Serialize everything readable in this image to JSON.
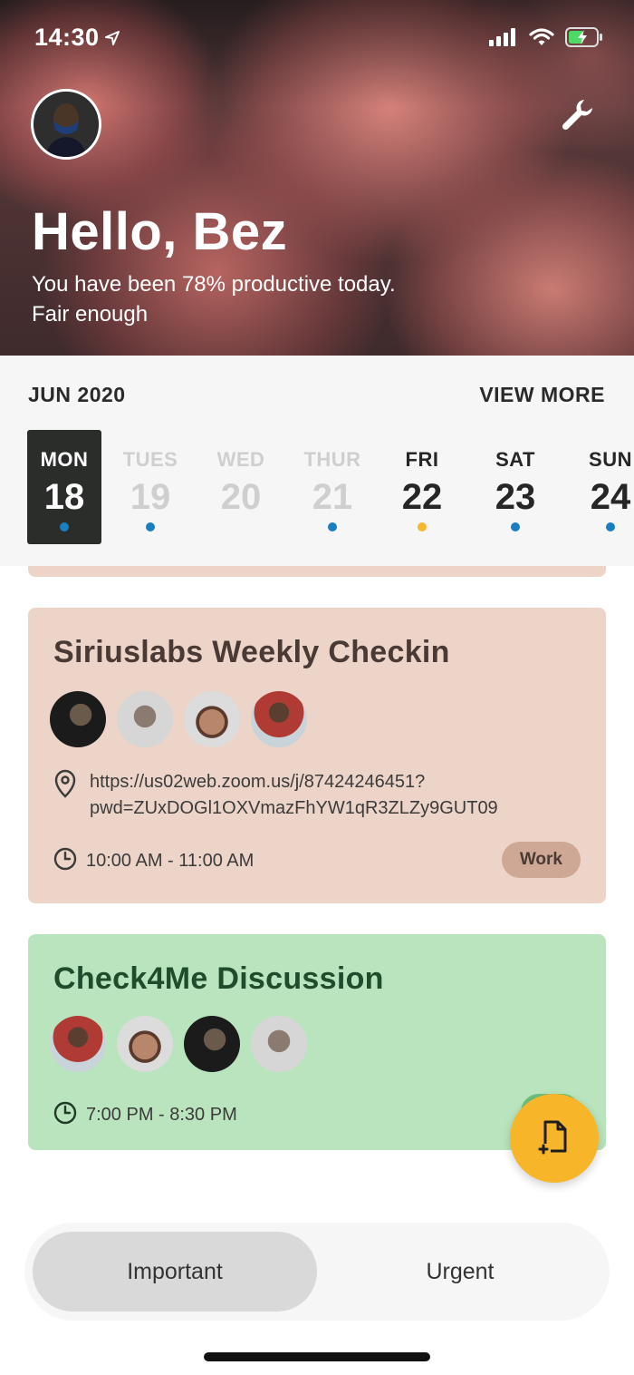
{
  "status_bar": {
    "time": "14:30",
    "icons": [
      "location-arrow-icon",
      "signal-icon",
      "wifi-icon",
      "battery-charging-icon"
    ],
    "battery_color": "#4cd964"
  },
  "header": {
    "greeting": "Hello, Bez",
    "line1": "You have been 78% productive today.",
    "line2": "Fair enough",
    "productivity_percent": 78,
    "settings_icon": "wrench-icon"
  },
  "calendar": {
    "month": "JUN 2020",
    "view_more": "VIEW MORE",
    "days": [
      {
        "name": "MON",
        "num": "18",
        "state": "selected",
        "dot": "#1a7fc0"
      },
      {
        "name": "TUES",
        "num": "19",
        "state": "past",
        "dot": "#1a7fc0"
      },
      {
        "name": "WED",
        "num": "20",
        "state": "past",
        "dot": null
      },
      {
        "name": "THUR",
        "num": "21",
        "state": "past",
        "dot": "#1a7fc0"
      },
      {
        "name": "FRI",
        "num": "22",
        "state": "future",
        "dot": "#f5b82e"
      },
      {
        "name": "SAT",
        "num": "23",
        "state": "future",
        "dot": "#1a7fc0"
      },
      {
        "name": "SUN",
        "num": "24",
        "state": "future",
        "dot": "#1a7fc0"
      }
    ]
  },
  "events": [
    {
      "title": "Siriuslabs Weekly Checkin",
      "location_line1": "https://us02web.zoom.us/j/87424246451?",
      "location_line2": "pwd=ZUxDOGl1OXVmazFhYW1qR3ZLZy9GUT09",
      "time": "10:00 AM - 11:00 AM",
      "tag": "Work",
      "color": "#edd4c8"
    },
    {
      "title": "Check4Me Discussion",
      "time": "7:00 PM - 8:30 PM",
      "tag": "Me",
      "color": "#b9e4bd"
    }
  ],
  "fab": {
    "icon": "add-note-icon",
    "color": "#f7b52a"
  },
  "toggle": {
    "active": "Important",
    "inactive": "Urgent"
  }
}
